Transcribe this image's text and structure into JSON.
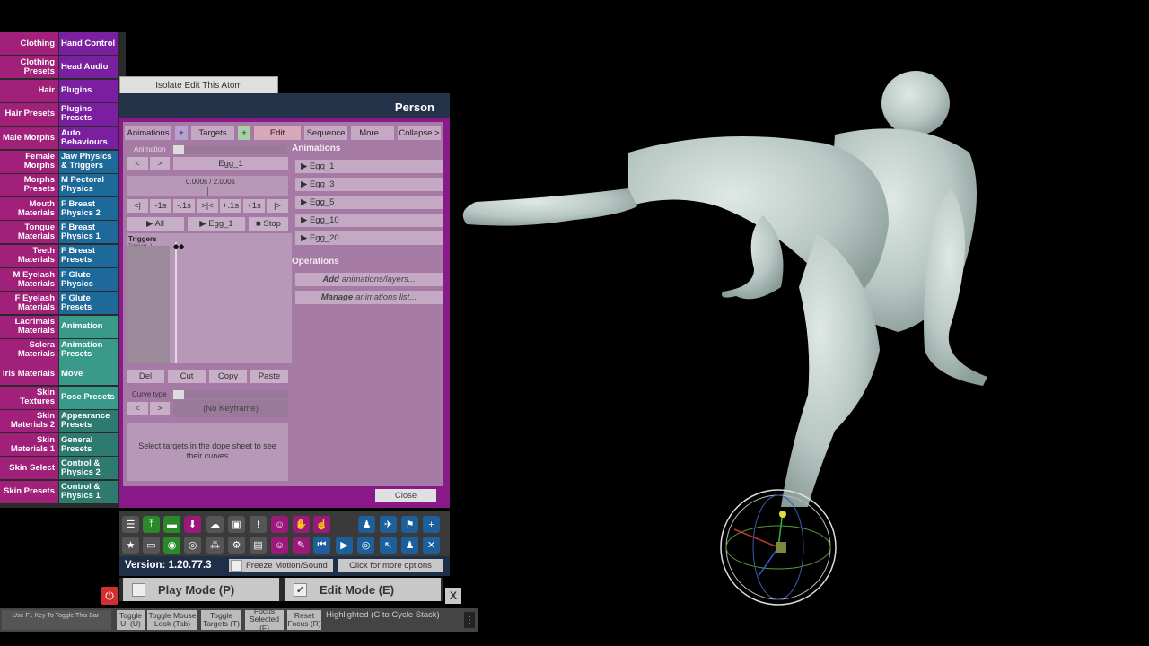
{
  "left_menu": [
    {
      "left": "Clothing",
      "right": "Hand Control",
      "rcolor": "pur"
    },
    {
      "left": "Clothing Presets",
      "right": "Head Audio",
      "rcolor": "pur"
    },
    {
      "left": "Hair",
      "right": "Plugins",
      "rcolor": "pur"
    },
    {
      "left": "Hair Presets",
      "right": "Plugins Presets",
      "rcolor": "pur"
    },
    {
      "left": "Male Morphs",
      "right": "Auto Behaviours",
      "rcolor": "pur"
    },
    {
      "left": "Female Morphs",
      "right": "Jaw Physics & Triggers",
      "rcolor": "blu"
    },
    {
      "left": "Morphs Presets",
      "right": "M Pectoral Physics",
      "rcolor": "blu"
    },
    {
      "left": "Mouth Materials",
      "right": "F Breast Physics 2",
      "rcolor": "blu"
    },
    {
      "left": "Tongue Materials",
      "right": "F Breast Physics 1",
      "rcolor": "blu"
    },
    {
      "left": "Teeth Materials",
      "right": "F Breast Presets",
      "rcolor": "blu"
    },
    {
      "left": "M Eyelash Materials",
      "right": "F Glute Physics",
      "rcolor": "blu"
    },
    {
      "left": "F Eyelash Materials",
      "right": "F Glute Presets",
      "rcolor": "blu"
    },
    {
      "left": "Lacrimals Materials",
      "right": "Animation",
      "rcolor": "tea"
    },
    {
      "left": "Sclera Materials",
      "right": "Animation Presets",
      "rcolor": "tea"
    },
    {
      "left": "Iris Materials",
      "right": "Move",
      "rcolor": "tea"
    },
    {
      "left": "Skin Textures",
      "right": "Pose Presets",
      "rcolor": "tea"
    },
    {
      "left": "Skin Materials 2",
      "right": "Appearance Presets",
      "rcolor": "dte"
    },
    {
      "left": "Skin Materials 1",
      "right": "General Presets",
      "rcolor": "dte"
    },
    {
      "left": "Skin Select",
      "right": "Control & Physics 2",
      "rcolor": "dte"
    },
    {
      "left": "Skin Presets",
      "right": "Control & Physics 1",
      "rcolor": "dte"
    }
  ],
  "isolate_label": "Isolate Edit This Atom",
  "panel": {
    "title": "Person",
    "tabs": {
      "animations": "Animations",
      "plus1": "+",
      "targets": "Targets",
      "plus2": "+",
      "edit": "Edit",
      "sequence": "Sequence",
      "more": "More...",
      "collapse": "Collapse >"
    },
    "animation_label": "Animation",
    "prev": "<",
    "next": ">",
    "current_anim": "Egg_1",
    "time_display": "0.000s / 2.000s",
    "step_buttons": [
      "<|",
      "-1s",
      "-.1s",
      ">|<",
      "+.1s",
      "+1s",
      "|>"
    ],
    "play_all": "▶ All",
    "play_current": "▶ Egg_1",
    "stop": "■ Stop",
    "triggers_label": "Triggers",
    "triggers_row": "Triggers 1",
    "edit_buttons": [
      "Del",
      "Cut",
      "Copy",
      "Paste"
    ],
    "curve_type_label": "Curve type",
    "no_keyframe": "(No Keyframe)",
    "select_targets_msg": "Select targets in the dope sheet to see their curves",
    "animations_header": "Animations",
    "animations_list": [
      "▶ Egg_1",
      "▶ Egg_3",
      "▶ Egg_5",
      "▶ Egg_10",
      "▶ Egg_20"
    ],
    "operations_header": "Operations",
    "op_add_bold": "Add",
    "op_add_rest": "animations/layers...",
    "op_manage_bold": "Manage",
    "op_manage_rest": "animations list...",
    "close": "Close"
  },
  "version": "Version: 1.20.77.3",
  "freeze_label": "Freeze Motion/Sound",
  "more_options": "Click for more options",
  "play_mode": "Play Mode (P)",
  "edit_mode": "Edit Mode (E)",
  "edit_mode_check": "✓",
  "close_x": "X",
  "f1_tip": "Use F1 Key To Toggle This Bar",
  "bottom_buttons": [
    {
      "label": "Toggle UI (U)"
    },
    {
      "label": "Toggle Mouse Look (Tab)"
    },
    {
      "label": "Toggle Targets (T)"
    },
    {
      "label": "Focus Selected (F)"
    },
    {
      "label": "Reset Focus (R)"
    }
  ],
  "highlighted_text": "Highlighted (C to Cycle Stack)",
  "menu_dots": "⋮",
  "colors": {
    "panel_bg": "#8a1a8a",
    "panel_inner": "#a57aa5",
    "header_navy": "#24324a",
    "magenta_menu": "#a0207a",
    "purple_menu": "#7a1fa0",
    "blue_menu": "#1d6a9a",
    "teal_menu": "#3a9a8a"
  }
}
